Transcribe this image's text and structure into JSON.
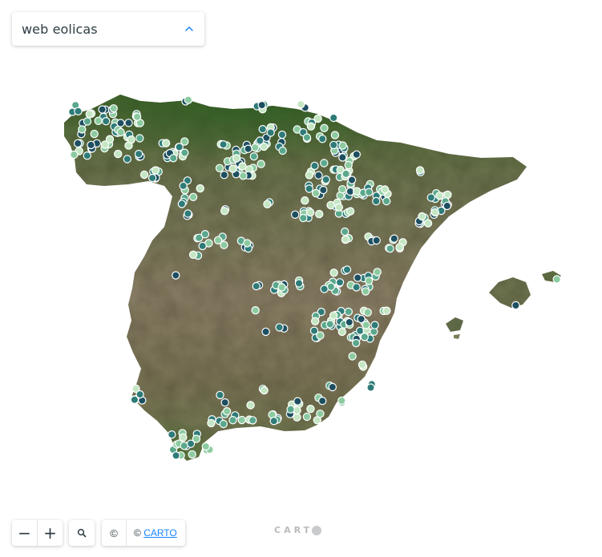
{
  "layer_selector": {
    "title": "web eolicas",
    "expanded": true,
    "chevron_icon": "chevron-up-icon"
  },
  "controls": {
    "zoom_out_label": "−",
    "zoom_in_label": "+",
    "search_icon": "search-icon",
    "attribution_toggle_label": "©",
    "attribution_prefix": "© ",
    "attribution_link": "CARTO"
  },
  "branding": {
    "logo_text": "CART"
  },
  "basemap": "satellite",
  "colors": {
    "accent": "#1785fb",
    "point_palette": [
      "#1d4f60",
      "#2e7b78",
      "#5aa88c",
      "#8ccba0",
      "#c4e6c3"
    ],
    "point_stroke": "#ffffff",
    "land_dark": "#44622f",
    "land_mid": "#7a7360",
    "land_light": "#9c8e76"
  }
}
